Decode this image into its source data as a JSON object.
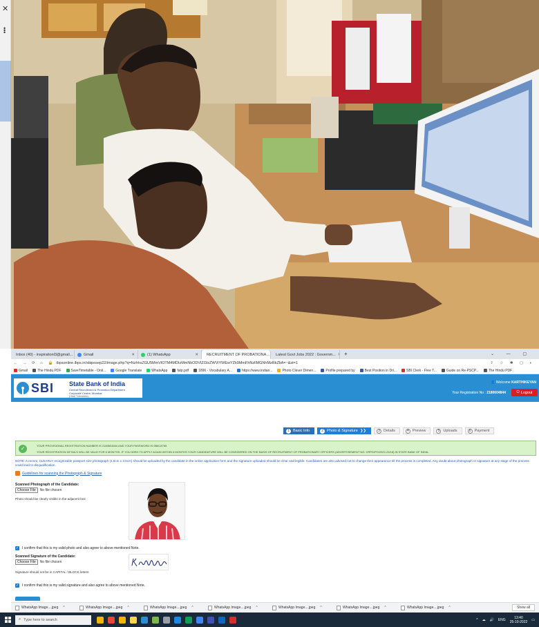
{
  "browser": {
    "tabs": [
      {
        "label": "Inbox (40) - inspirationl3@gmail...",
        "color": "#d93025"
      },
      {
        "label": "Gmail",
        "color": "#4285f4"
      },
      {
        "label": "(1) WhatsApp",
        "color": "#25d366"
      },
      {
        "label": "RECRUITMENT OF PROBATIONA...",
        "color": "#555555",
        "active": true
      },
      {
        "label": "Latest Govt Jobs 2022 : Governm...",
        "color": "#e8453c"
      }
    ],
    "url": "ibpsonline.ibps.in/sbiposep22/image.php?q=NzhhxZGU5MmVlOTM4MDIzMmNkODVlZGIxZWViYWEwYZk0MmFhNzllMGNhMzRkZkA=~&st=1",
    "bookmarks": [
      {
        "label": "Gmail",
        "color": "#d93025"
      },
      {
        "label": "The Hindu PDF",
        "color": "#555555"
      },
      {
        "label": "SaveTimetable - Onli...",
        "color": "#34a853"
      },
      {
        "label": "Google Translate",
        "color": "#4285f4"
      },
      {
        "label": "WhatsApp",
        "color": "#25d366"
      },
      {
        "label": "fatp.pdf",
        "color": "#555555"
      },
      {
        "label": "1896 - Vocabulary A...",
        "color": "#555555"
      },
      {
        "label": "https://www.indian...",
        "color": "#1a73e8"
      },
      {
        "label": "Photo Clever Dimen...",
        "color": "#f4b400"
      },
      {
        "label": "Profile prepared by",
        "color": "#3b5998"
      },
      {
        "label": "Best Position in Dri...",
        "color": "#3b5998"
      },
      {
        "label": "SBI Clerk - Free T...",
        "color": "#d93025"
      },
      {
        "label": "Guide on Re-PSCP...",
        "color": "#555555"
      },
      {
        "label": "The Hindu PDF",
        "color": "#555555"
      }
    ]
  },
  "header": {
    "logo_text": "SBI",
    "bank_name": "State Bank of India",
    "dept_line1": "Central Recruitment & Promotion Department",
    "dept_line2": "Corporate Centre, Mumbai",
    "dept_line3": "(Hindi Translation)",
    "welcome_prefix": "Welcome",
    "welcome_name": "KARTHIKEYAN",
    "reg_label": "Your Registration No :",
    "reg_no": "2180604844",
    "logout_label": "Logout"
  },
  "steps": [
    {
      "num": "1",
      "label": "Basic Info",
      "state": "done"
    },
    {
      "num": "2",
      "label": "Photo & Signature",
      "state": "current"
    },
    {
      "num": "3",
      "label": "Details",
      "state": "pending"
    },
    {
      "num": "4",
      "label": "Preview",
      "state": "pending"
    },
    {
      "num": "5",
      "label": "Uploads",
      "state": "pending"
    },
    {
      "num": "6",
      "label": "Payment",
      "state": "pending"
    }
  ],
  "message": {
    "line1": "YOUR PROVISIONAL REGISTRATION NUMBER IS 2180604844 AND YOUR PASSWORD IS 0B6C8769.",
    "line2": "YOUR REGISTRATION DETAILS WILL BE VALID FOR 6 MONTHS. IF YOU WISH TO APPLY AGAIN WITHIN 6 MONTHS YOUR CANDIDATURE WILL BE CONSIDERED ON THE BASIS OF RECRUITMENT OF PROBATIONARY OFFICERS (ADVERTISEMENT NO: CRPD/PO/2022-23/18) IN STATE BANK OF INDIA."
  },
  "note_text": "NOTE: A recent, CLEARLY recognizable passport size photograph (4.5cm x 3.5cm) should be uploaded by the candidate in the online application form and the signature uploaded should be clear and legible. Candidates are also advised not to change their appearance till the process is completed. Any doubt about photograph or signature at any stage of the process could lead to disqualification.",
  "guidelines_link": "Guidelines for scanning the Photograph & Signature",
  "photo_section": {
    "label": "Scanned Photograph of the Candidate:",
    "choose_btn": "Choose File",
    "no_file": "No file chosen",
    "hint": "Photo should be clearly visible in the adjacent box",
    "confirm": "I confirm that this is my valid photo and also agree to above mentioned Note."
  },
  "signature_section": {
    "label": "Scanned Signature of the Candidate:",
    "choose_btn": "Choose File",
    "no_file": "No file chosen",
    "hint": "Signature should not be in CAPITAL / BLOCK letters",
    "sig_text": "k karthikeyan",
    "confirm": "I confirm that this is my valid signature and also agree to above mentioned Note."
  },
  "downloads": {
    "items": [
      "WhatsApp Image....jpeg",
      "WhatsApp Image....jpeg",
      "WhatsApp Image....jpeg",
      "WhatsApp Image....jpeg",
      "WhatsApp Image....jpeg",
      "WhatsApp Image....jpeg",
      "WhatsApp Image....jpeg"
    ],
    "show_all": "Show all"
  },
  "taskbar": {
    "search_placeholder": "Type here to search",
    "lang": "ENG",
    "time": "13:40",
    "date": "25-10-2022"
  }
}
